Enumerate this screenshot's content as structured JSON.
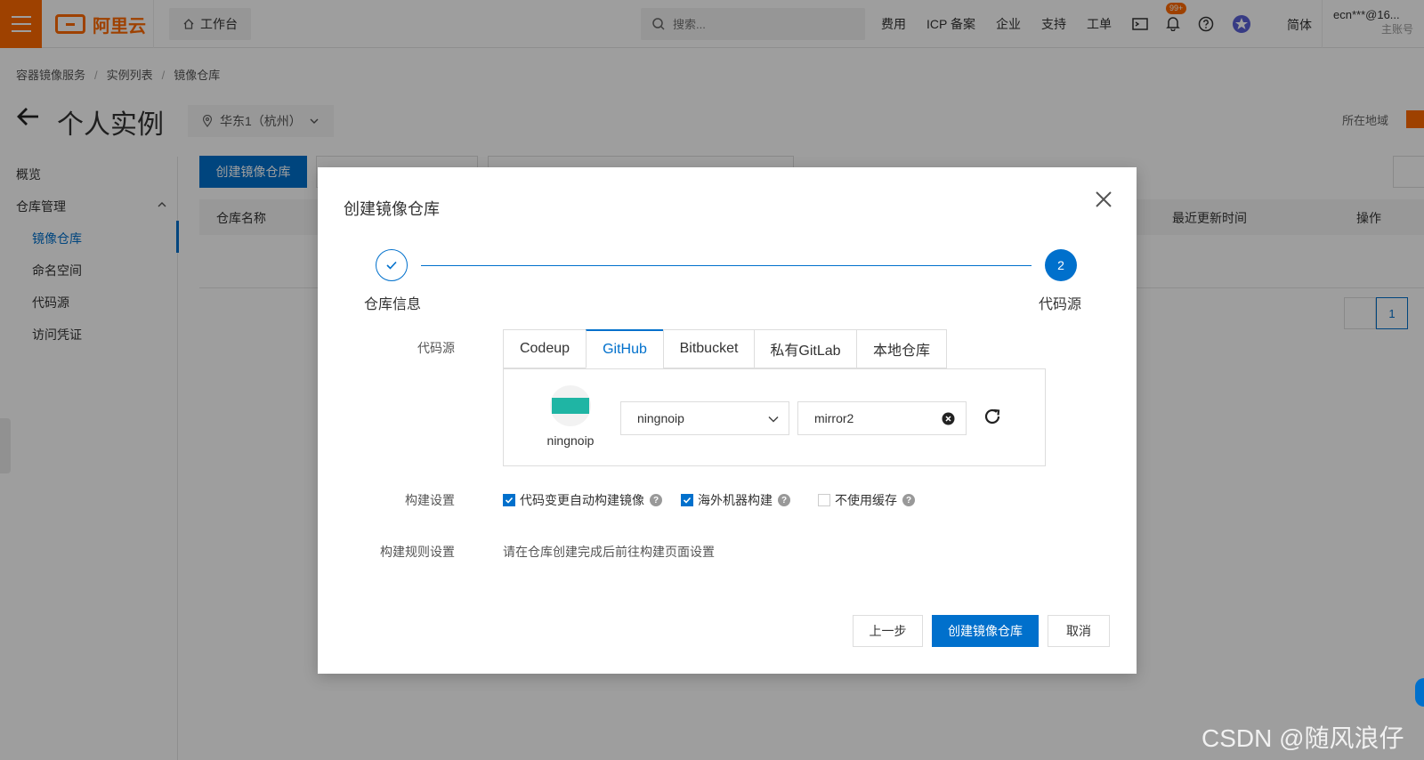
{
  "topbar": {
    "logo_text": "阿里云",
    "workbench": "工作台",
    "search_placeholder": "搜索...",
    "nav": [
      "费用",
      "ICP 备案",
      "企业",
      "支持",
      "工单"
    ],
    "notification_badge": "99+",
    "language": "简体",
    "account": "ecn***@16...",
    "account_type": "主账号"
  },
  "breadcrumb": [
    "容器镜像服务",
    "实例列表",
    "镜像仓库"
  ],
  "page": {
    "title": "个人实例",
    "region": "华东1（杭州）",
    "region_right": "所在地域"
  },
  "sidebar": {
    "items": [
      {
        "label": "概览"
      },
      {
        "label": "仓库管理"
      },
      {
        "label": "镜像仓库"
      },
      {
        "label": "命名空间"
      },
      {
        "label": "代码源"
      },
      {
        "label": "访问凭证"
      }
    ]
  },
  "main": {
    "create_button": "创建镜像仓库",
    "table_headers": [
      "仓库名称",
      "最近更新时间",
      "操作"
    ],
    "page_number": "1"
  },
  "modal": {
    "title": "创建镜像仓库",
    "steps": [
      {
        "label": "仓库信息"
      },
      {
        "label": "代码源",
        "number": "2"
      }
    ],
    "code_source_label": "代码源",
    "tabs": [
      "Codeup",
      "GitHub",
      "Bitbucket",
      "私有GitLab",
      "本地仓库"
    ],
    "active_tab": "GitHub",
    "account_name": "ningnoip",
    "owner_select": "ningnoip",
    "repo_value": "mirror2",
    "build_settings_label": "构建设置",
    "checks": [
      {
        "label": "代码变更自动构建镜像",
        "checked": true
      },
      {
        "label": "海外机器构建",
        "checked": true
      },
      {
        "label": "不使用缓存",
        "checked": false
      }
    ],
    "build_rules_label": "构建规则设置",
    "build_rules_text": "请在仓库创建完成后前往构建页面设置",
    "buttons": {
      "prev": "上一步",
      "create": "创建镜像仓库",
      "cancel": "取消"
    }
  },
  "watermark": "CSDN @随风浪仔",
  "colors": {
    "brand": "#ff6a00",
    "primary": "#0070cc"
  }
}
